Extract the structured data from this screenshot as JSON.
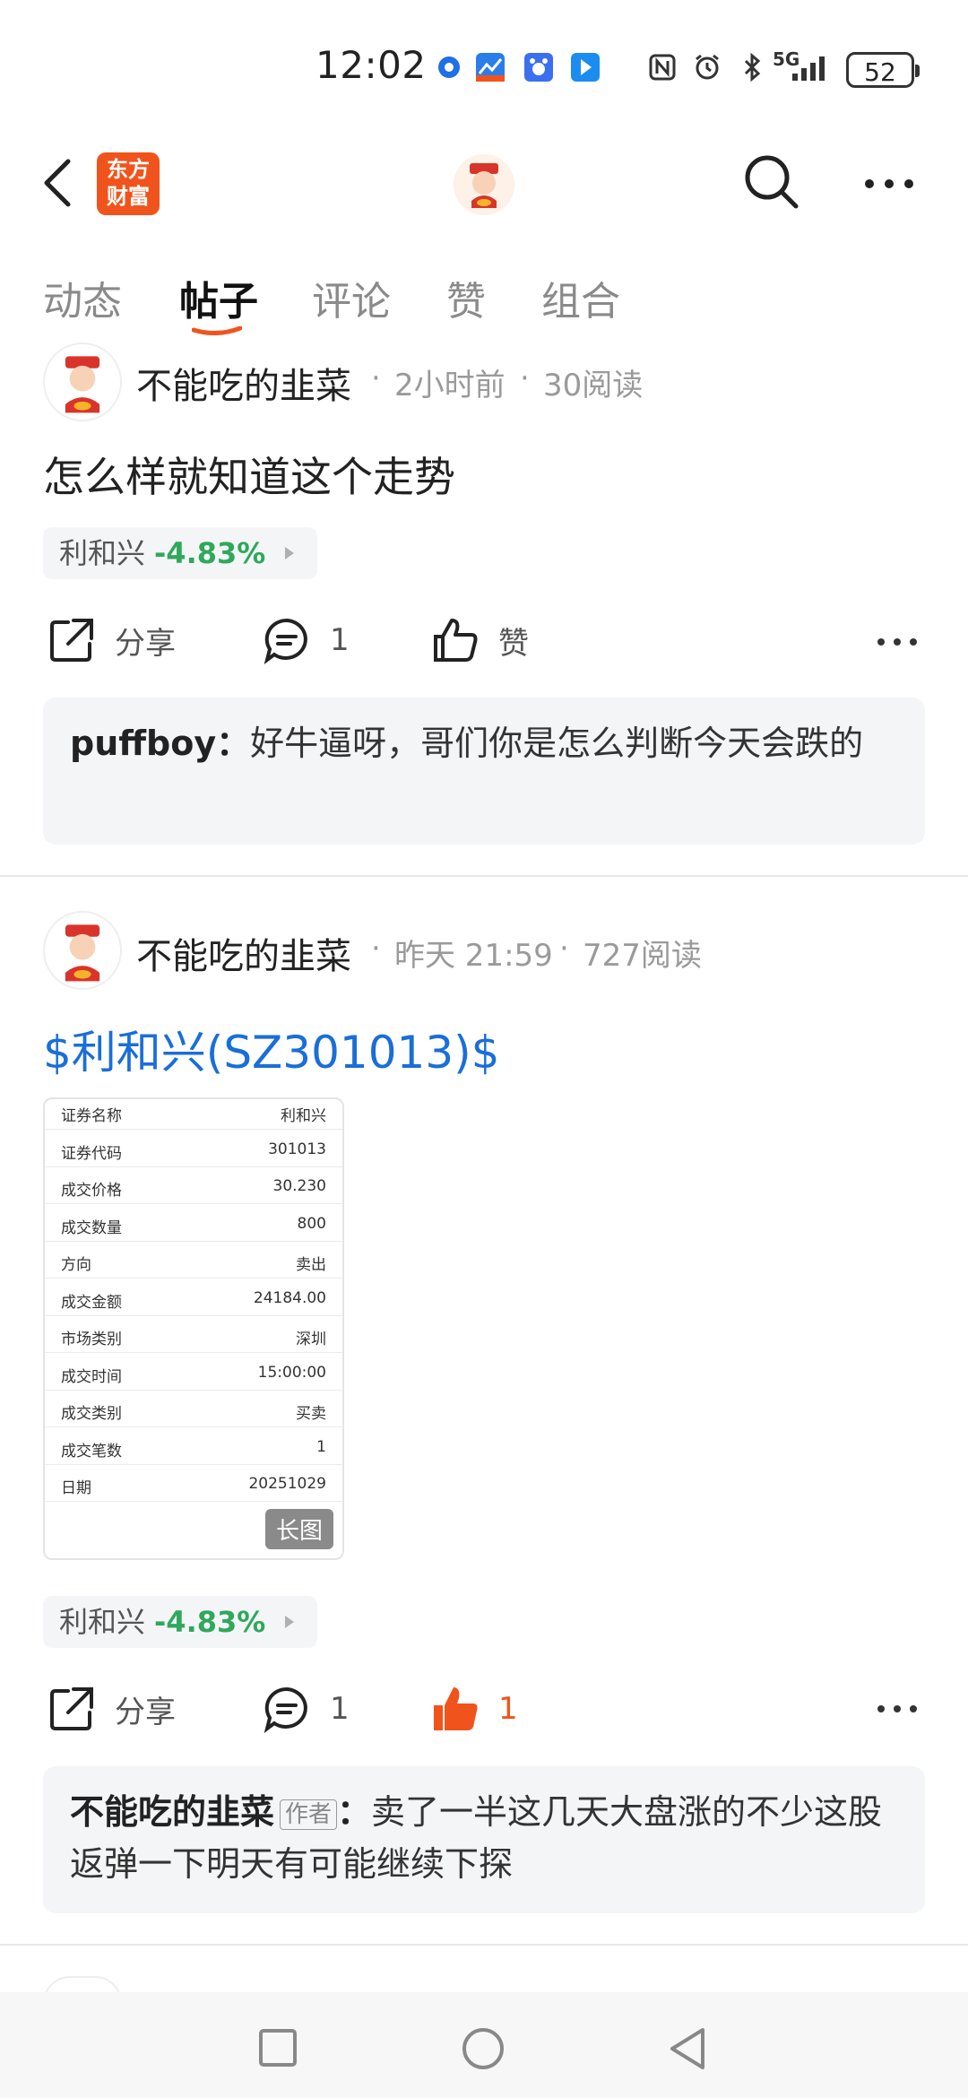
{
  "status_bar": {
    "time": "12:02",
    "network": "5G",
    "battery": "52",
    "icons": [
      "browser-icon",
      "stock-app-icon",
      "baidu-icon",
      "share-app-icon",
      "nfc-icon",
      "alarm-icon",
      "bluetooth-icon",
      "signal-icon"
    ]
  },
  "header": {
    "back_icon": "chevron-left-icon",
    "app_logo_text": "东方财富",
    "avatar_icon": "god-of-wealth-avatar",
    "search_icon": "search-icon",
    "more_icon": "more-horizontal-icon"
  },
  "tabs": [
    {
      "label": "动态",
      "active": false
    },
    {
      "label": "帖子",
      "active": true
    },
    {
      "label": "评论",
      "active": false
    },
    {
      "label": "赞",
      "active": false
    },
    {
      "label": "组合",
      "active": false
    }
  ],
  "posts": [
    {
      "author": "不能吃的韭菜",
      "time": "2小时前",
      "reads": "30阅读",
      "title": "怎么样就知道这个走势",
      "stock": {
        "name": "利和兴",
        "change": "-4.83%"
      },
      "actions": {
        "share": "分享",
        "comments": "1",
        "like": "赞"
      },
      "comment": {
        "name": "puffboy",
        "sep": "：",
        "text": "好牛逼呀，哥们你是怎么判断今天会跌的"
      }
    },
    {
      "author": "不能吃的韭菜",
      "time": "昨天 21:59",
      "reads": "727阅读",
      "title": "$利和兴(SZ301013)$",
      "trade_table": [
        {
          "k": "证券名称",
          "v": "利和兴"
        },
        {
          "k": "证券代码",
          "v": "301013"
        },
        {
          "k": "成交价格",
          "v": "30.230"
        },
        {
          "k": "成交数量",
          "v": "800"
        },
        {
          "k": "方向",
          "v": "卖出"
        },
        {
          "k": "成交金额",
          "v": "24184.00"
        },
        {
          "k": "市场类别",
          "v": "深圳"
        },
        {
          "k": "成交时间",
          "v": "15:00:00"
        },
        {
          "k": "成交类别",
          "v": "买卖"
        },
        {
          "k": "成交笔数",
          "v": "1"
        },
        {
          "k": "日期",
          "v": "20251029"
        }
      ],
      "long_image_tag": "长图",
      "stock": {
        "name": "利和兴",
        "change": "-4.83%"
      },
      "actions": {
        "share": "分享",
        "comments": "1",
        "likes": "1"
      },
      "comment": {
        "name": "不能吃的韭菜",
        "tag": "作者",
        "sep": "：",
        "text": "卖了一半这几天大盘涨的不少这股返弹一下明天有可能继续下探"
      }
    }
  ],
  "meta_dot": "·",
  "colors": {
    "accent": "#f0541c",
    "link": "#1a6ed8",
    "down": "#2fa85c",
    "chip_bg": "#f4f5f7"
  }
}
